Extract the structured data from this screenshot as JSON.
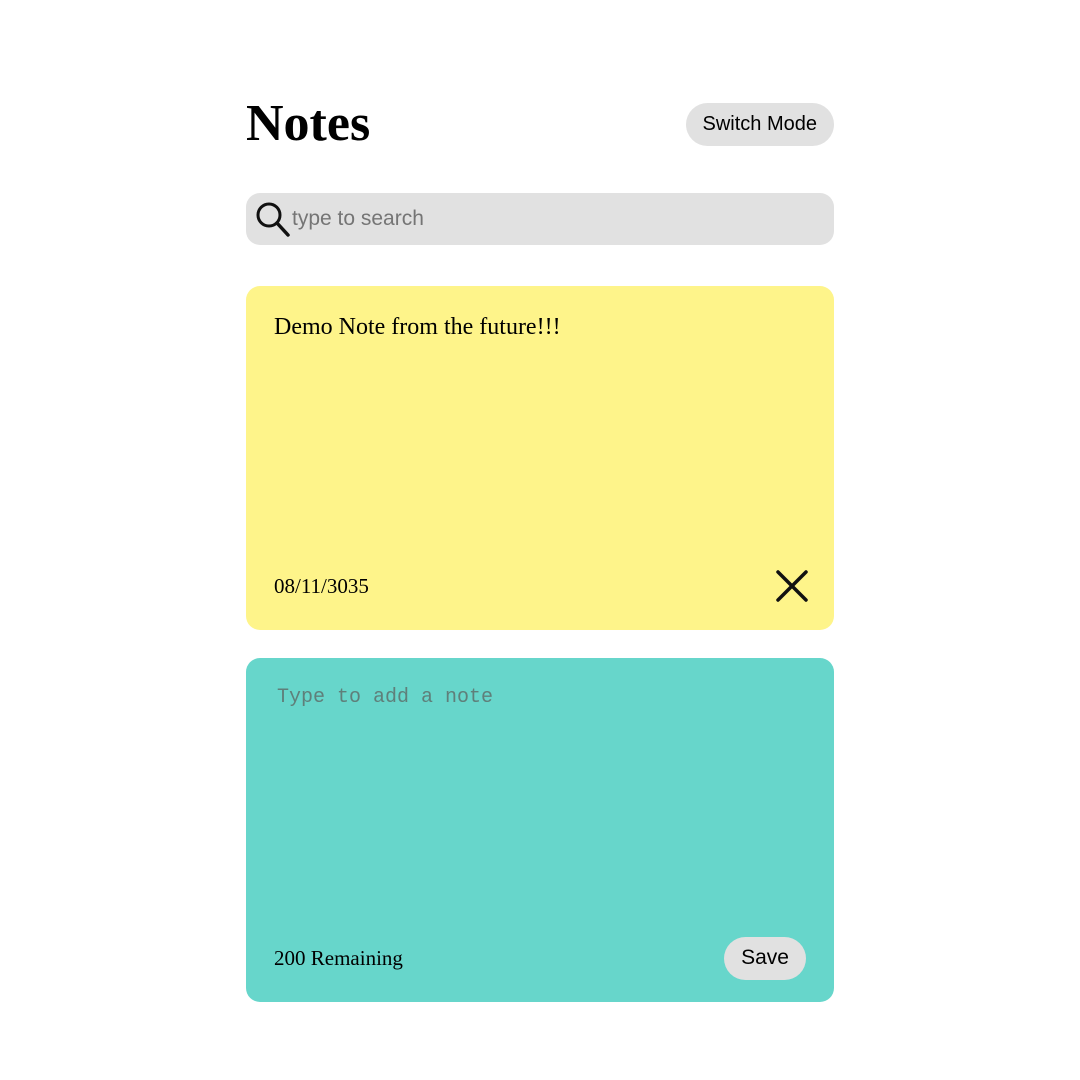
{
  "header": {
    "title": "Notes",
    "switch_mode_label": "Switch Mode"
  },
  "search": {
    "placeholder": "type to search",
    "icon": "search-icon"
  },
  "notes": [
    {
      "text": "Demo Note from the future!!!",
      "date": "08/11/3035",
      "delete_icon": "close-icon"
    }
  ],
  "add_note": {
    "placeholder": "Type to add a note",
    "remaining": "200 Remaining",
    "save_label": "Save"
  },
  "colors": {
    "button_bg": "#e1e1e1",
    "search_bg": "#e1e1e1",
    "note_bg": "#fef48a",
    "new_note_bg": "#67d6cb"
  }
}
